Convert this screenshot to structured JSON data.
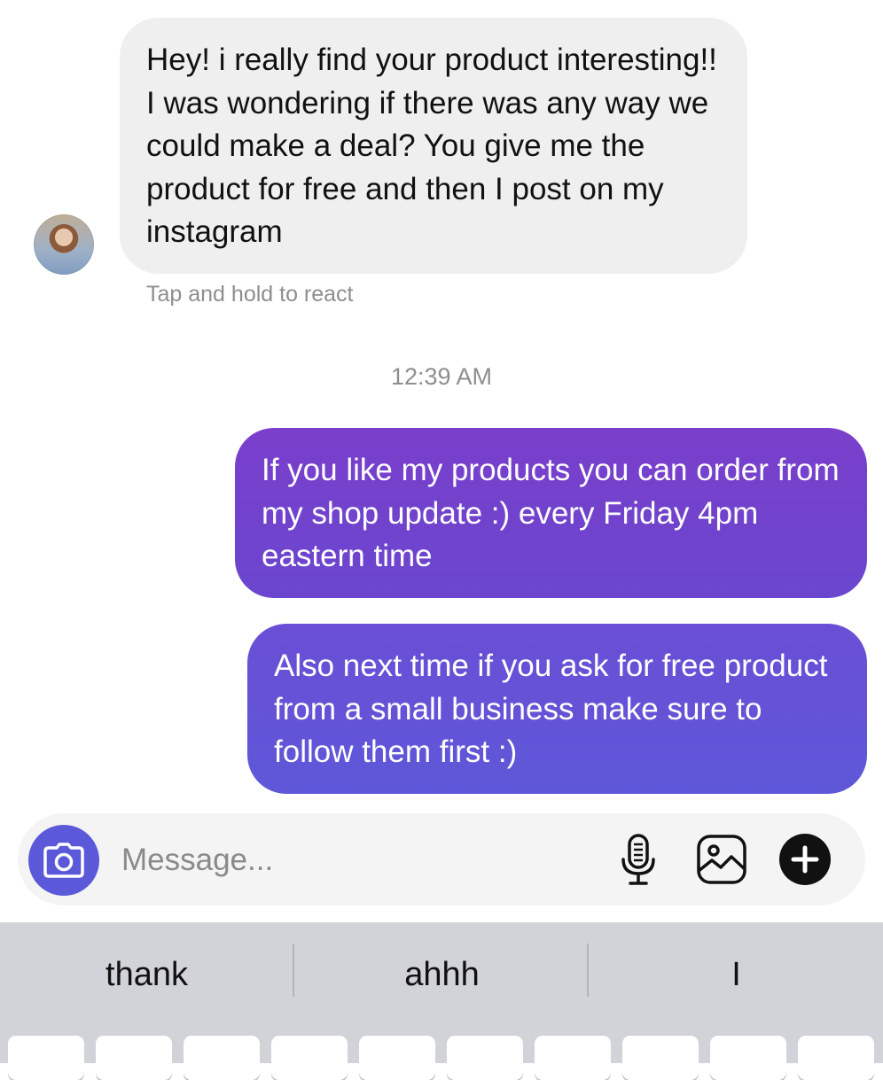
{
  "thread": {
    "incoming_message": "Hey! i really find your product interesting!! I was wondering if there was any way we could make a deal? You give me the product for free and then I post on my instagram",
    "react_hint": "Tap and hold to react",
    "timestamp": "12:39 AM",
    "outgoing_messages": [
      "If you like my products you can order from my shop update :) every Friday 4pm eastern time",
      "Also next time if you ask for free product from a small business make sure to follow them first :)"
    ]
  },
  "composer": {
    "placeholder": "Message...",
    "value": "",
    "icons": [
      "camera-icon",
      "microphone-icon",
      "gallery-icon",
      "plus-icon"
    ],
    "accent_color": "#5b59d9"
  },
  "keyboard": {
    "suggestions": [
      "thank",
      "ahhh",
      "I"
    ]
  },
  "colors": {
    "incoming_bubble": "#efefef",
    "outgoing_gradient_top": "#7a3fcb",
    "outgoing_gradient_bottom": "#5e57d8",
    "keyboard_bg": "#d2d3d9"
  }
}
